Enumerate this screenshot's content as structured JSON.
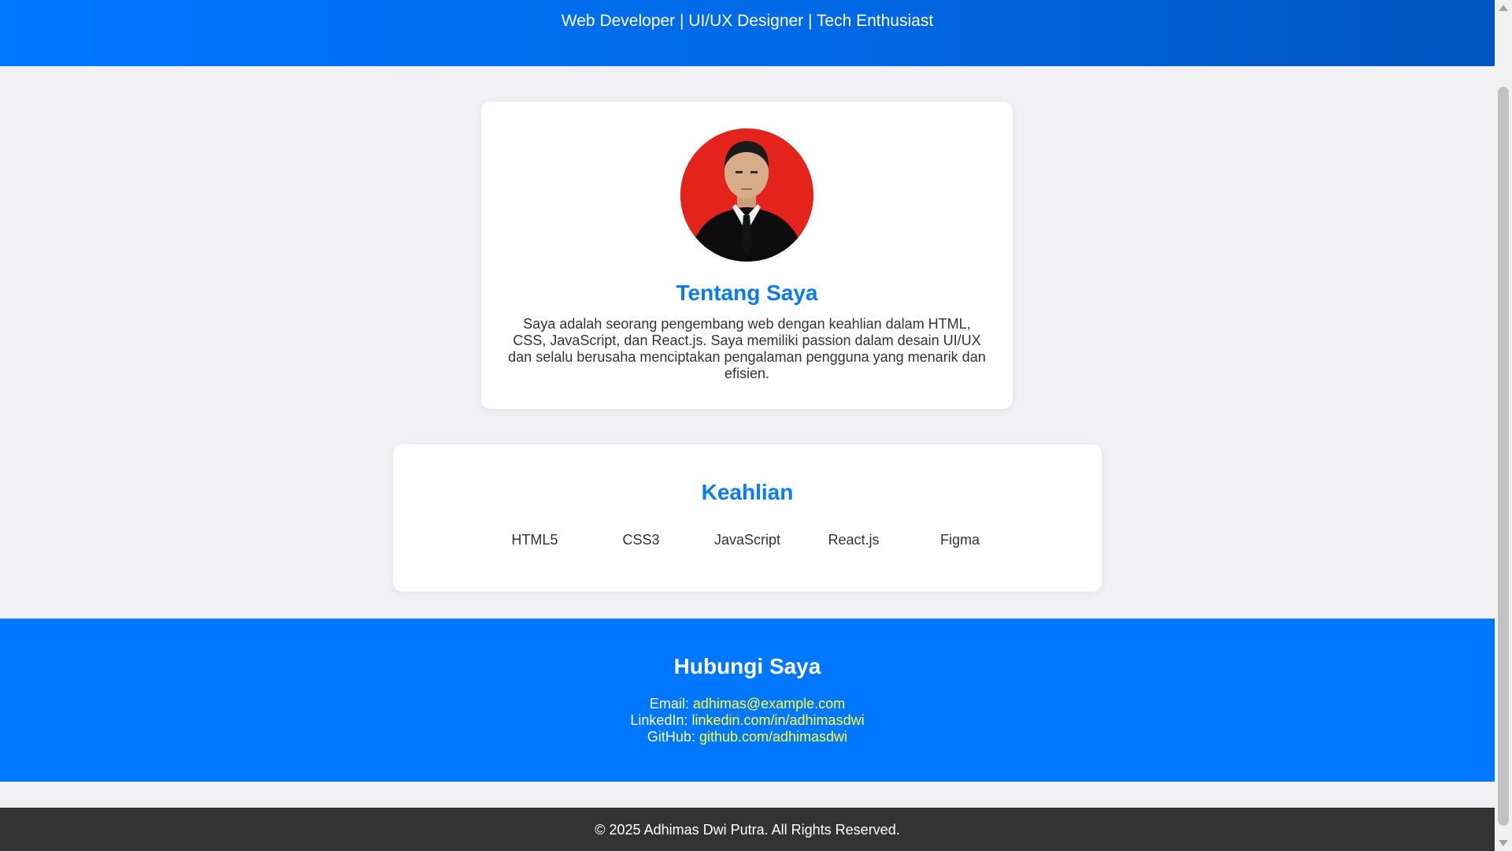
{
  "hero": {
    "tagline": "Web Developer | UI/UX Designer | Tech Enthusiast"
  },
  "about": {
    "title": "Tentang Saya",
    "text": "Saya adalah seorang pengembang web dengan keahlian dalam HTML, CSS, JavaScript, dan React.js. Saya memiliki passion dalam desain UI/UX dan selalu berusaha menciptakan pengalaman pengguna yang menarik dan efisien."
  },
  "skills": {
    "title": "Keahlian",
    "items": [
      "HTML5",
      "CSS3",
      "JavaScript",
      "React.js",
      "Figma"
    ]
  },
  "contact": {
    "title": "Hubungi Saya",
    "email_label": "Email: ",
    "email_value": "adhimas@example.com",
    "linkedin_label": "LinkedIn: ",
    "linkedin_value": "linkedin.com/in/adhimasdwi",
    "github_label": "GitHub: ",
    "github_value": "github.com/adhimasdwi"
  },
  "footer": {
    "text": "© 2025 Adhimas Dwi Putra. All Rights Reserved."
  },
  "colors": {
    "brand_blue": "#0077ff",
    "heading_blue": "#0a7bf0",
    "link_yellow": "#ffff33",
    "footer_dark": "#333333",
    "page_bg": "#f0f0f5"
  }
}
